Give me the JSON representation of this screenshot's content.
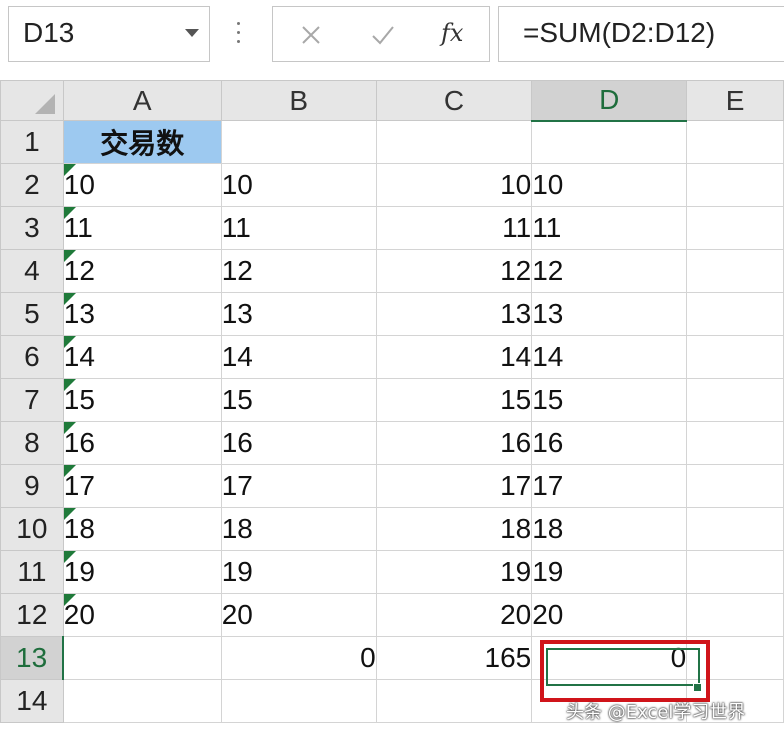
{
  "formula_bar": {
    "name_box": "D13",
    "fx_label": "fx",
    "formula": "=SUM(D2:D12)"
  },
  "columns": [
    "A",
    "B",
    "C",
    "D",
    "E"
  ],
  "rows": [
    "1",
    "2",
    "3",
    "4",
    "5",
    "6",
    "7",
    "8",
    "9",
    "10",
    "11",
    "12",
    "13",
    "14"
  ],
  "cells": {
    "A1": "交易数",
    "A": [
      "10",
      "11",
      "12",
      "13",
      "14",
      "15",
      "16",
      "17",
      "18",
      "19",
      "20"
    ],
    "B": [
      "10",
      "11",
      "12",
      "13",
      "14",
      "15",
      "16",
      "17",
      "18",
      "19",
      "20"
    ],
    "C": [
      "10",
      "11",
      "12",
      "13",
      "14",
      "15",
      "16",
      "17",
      "18",
      "19",
      "20"
    ],
    "D": [
      "10",
      "11",
      "12",
      "13",
      "14",
      "15",
      "16",
      "17",
      "18",
      "19",
      "20"
    ],
    "B13": "0",
    "C13": "165",
    "D13": "0"
  },
  "selection": {
    "active_cell": "D13",
    "active_column": "D",
    "active_row": "13"
  },
  "colors": {
    "header_fill": "#9dc9f0",
    "select_green": "#217346",
    "highlight_red": "#d0141a"
  },
  "watermark": "头条 @Excel学习世界"
}
